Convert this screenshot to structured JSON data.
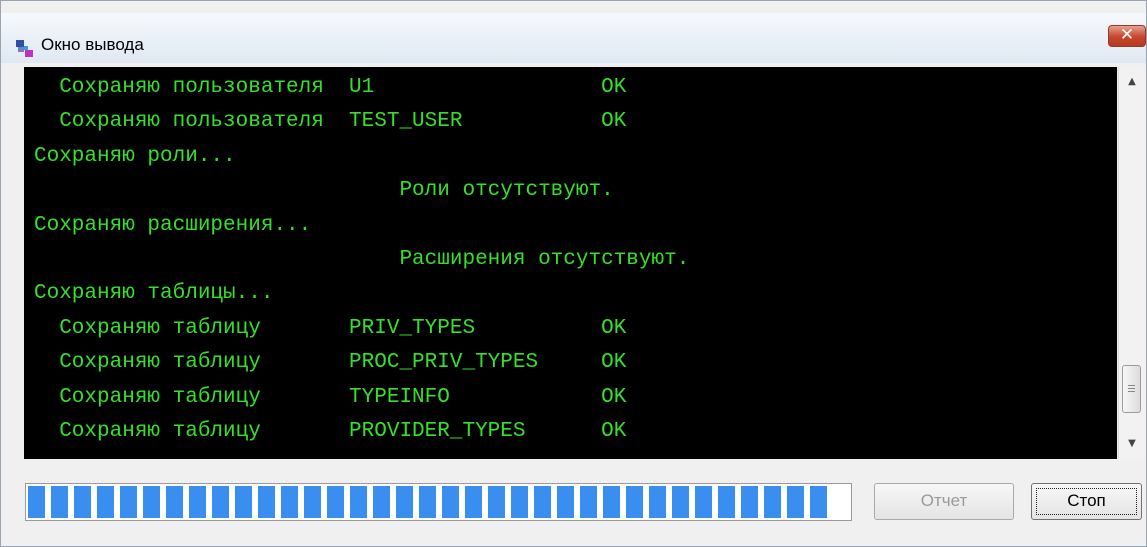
{
  "window": {
    "title": "Окно вывода",
    "icon": "output-window-icon",
    "close_icon": "close-icon"
  },
  "console": {
    "text_color": "#34e02a",
    "background": "#000000",
    "lines": [
      "  Сохраняю пользователя  U1                  OK",
      "  Сохраняю пользователя  TEST_USER           OK",
      "Сохраняю роли...",
      "                             Роли отсутствуют.",
      "Сохраняю расширения...",
      "                             Расширения отсутствуют.",
      "Сохраняю таблицы...",
      "  Сохраняю таблицу       PRIV_TYPES          OK",
      "  Сохраняю таблицу       PROC_PRIV_TYPES     OK",
      "  Сохраняю таблицу       TYPEINFO            OK",
      "  Сохраняю таблицу       PROVIDER_TYPES      OK"
    ]
  },
  "progress": {
    "fraction": 1.0,
    "color": "#3a8ef0"
  },
  "buttons": {
    "report_label": "Отчет",
    "stop_label": "Стоп"
  }
}
